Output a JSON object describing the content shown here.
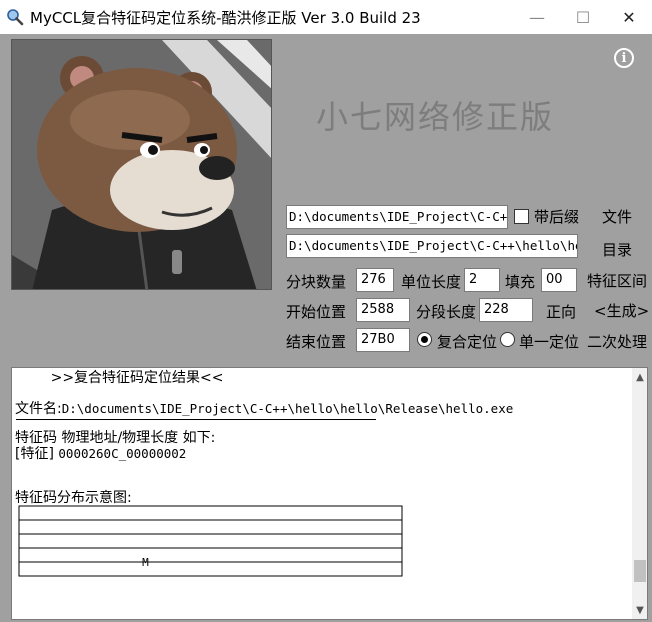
{
  "window": {
    "title": "MyCCL复合特征码定位系统-酷洪修正版  Ver 3.0  Build 23",
    "min_glyph": "—",
    "max_glyph": "☐",
    "close_glyph": "✕"
  },
  "banner": "小七网络修正版",
  "info_glyph": "i",
  "file_path": "D:\\documents\\IDE_Project\\C-C++\\hello\\hello\\Release\\hello.exe",
  "dir_path": "D:\\documents\\IDE_Project\\C-C++\\hello\\hello\\Release",
  "suffix_checkbox": {
    "label": "带后缀",
    "checked": false
  },
  "buttons": {
    "file": "文件",
    "dir": "目录",
    "feature_region": "特征区间",
    "generate": "<生成>",
    "second_process": "二次处理"
  },
  "fields": {
    "block_count_label": "分块数量",
    "block_count": "276",
    "unit_length_label": "单位长度",
    "unit_length": "2",
    "fill_label": "填充",
    "fill": "00",
    "start_label": "开始位置",
    "start": "2588",
    "segment_label": "分段长度",
    "segment": "228",
    "direction_label": "正向",
    "end_label": "结束位置",
    "end": "27B0"
  },
  "mode": {
    "composite_label": "复合定位",
    "single_label": "单一定位",
    "selected": "composite"
  },
  "result": {
    "heading": "        >>复合特征码定位结果<<",
    "filename_label": "文件名:",
    "filename": "D:\\documents\\IDE_Project\\C-C++\\hello\\hello\\Release\\hello.exe",
    "feature_header": "特征码 物理地址/物理长度 如下:",
    "feature_tag": "[特征]",
    "feature_value": "0000260C_00000002",
    "map_title": "特征码分布示意图:",
    "map_marker": "M",
    "marker_position": 0.33
  },
  "scroll": {
    "up_glyph": "▲",
    "down_glyph": "▼",
    "position": 0.9
  }
}
